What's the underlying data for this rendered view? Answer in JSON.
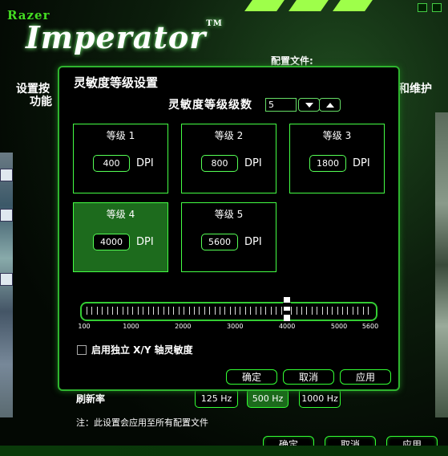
{
  "brand": {
    "small": "Razer",
    "big": "Imperator",
    "tm": "TM"
  },
  "background": {
    "profile_label": "配置文件:",
    "tab_left_line1": "设置按",
    "tab_left_line2": "功能",
    "tab_right": "和维护",
    "refresh_label": "刷新率",
    "refresh_options": [
      "125 Hz",
      "500 Hz",
      "1000 Hz"
    ],
    "refresh_selected": "500 Hz",
    "note": "注：此设置会应用至所有配置文件",
    "ok": "确定",
    "cancel": "取消",
    "apply": "应用"
  },
  "dialog": {
    "title": "灵敏度等级设置",
    "count_label": "灵敏度等级级数",
    "count_value": "5",
    "levels": [
      {
        "name": "等级 1",
        "dpi": "400",
        "unit": "DPI"
      },
      {
        "name": "等级 2",
        "dpi": "800",
        "unit": "DPI"
      },
      {
        "name": "等级 3",
        "dpi": "1800",
        "unit": "DPI"
      },
      {
        "name": "等级 4",
        "dpi": "4000",
        "unit": "DPI"
      },
      {
        "name": "等级 5",
        "dpi": "5600",
        "unit": "DPI"
      }
    ],
    "active_level": 4,
    "slider_labels": [
      "100",
      "1000",
      "2000",
      "3000",
      "4000",
      "5000",
      "5600"
    ],
    "slider_value": 4000,
    "xy_checkbox_label": "启用独立 X/Y 轴灵敏度",
    "xy_checked": false,
    "ok": "确定",
    "cancel": "取消",
    "apply": "应用"
  },
  "colors": {
    "accent": "#33ff33",
    "active_box": "#1d6b1d"
  }
}
